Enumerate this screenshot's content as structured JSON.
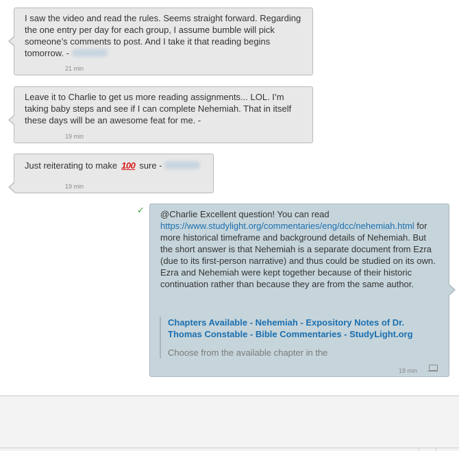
{
  "messages": [
    {
      "direction": "incoming",
      "text": "I saw the video and read the rules. Seems straight forward. Regarding the one entry per day for each group, I assume bumble will pick someone’s comments to post. And I take it that reading begins tomorrow. -",
      "time": "21 min"
    },
    {
      "direction": "incoming",
      "text": "Leave it to Charlie to get us more reading assignments... LOL. I’m taking baby steps and see if I can complete Nehemiah. That in itself these days will be an awesome feat for me. -",
      "time": "19 min"
    },
    {
      "direction": "incoming",
      "text_before": "Just reiterating to make",
      "emoji": "100",
      "text_after": "sure -",
      "time": "19 min"
    },
    {
      "direction": "outgoing",
      "text_before": "@Charlie Excellent question! You can read",
      "link": "https://www.studylight.org/commentaries/eng/dcc/nehemiah.html",
      "text_after": "for more historical timeframe and background details of Nehemiah. But the short answer is that Nehemiah is a separate document from Ezra (due to its first-person narrative) and thus could be studied on its own. Ezra and Nehemiah were kept together because of their historic continuation rather than because they are from the same author.",
      "preview_title": "Chapters Available - Nehemiah - Expository Notes of Dr. Thomas Constable - Bible Commentaries - StudyLight.org",
      "preview_desc": "Choose from the available chapter in the",
      "time": "18 min",
      "status_icon": "check-icon",
      "device_icon": "laptop-icon"
    }
  ],
  "colors": {
    "incoming_bg": "#e8e8e8",
    "outgoing_bg": "#c6d5db",
    "link": "#1a6fb0",
    "check": "#3ca33c"
  }
}
